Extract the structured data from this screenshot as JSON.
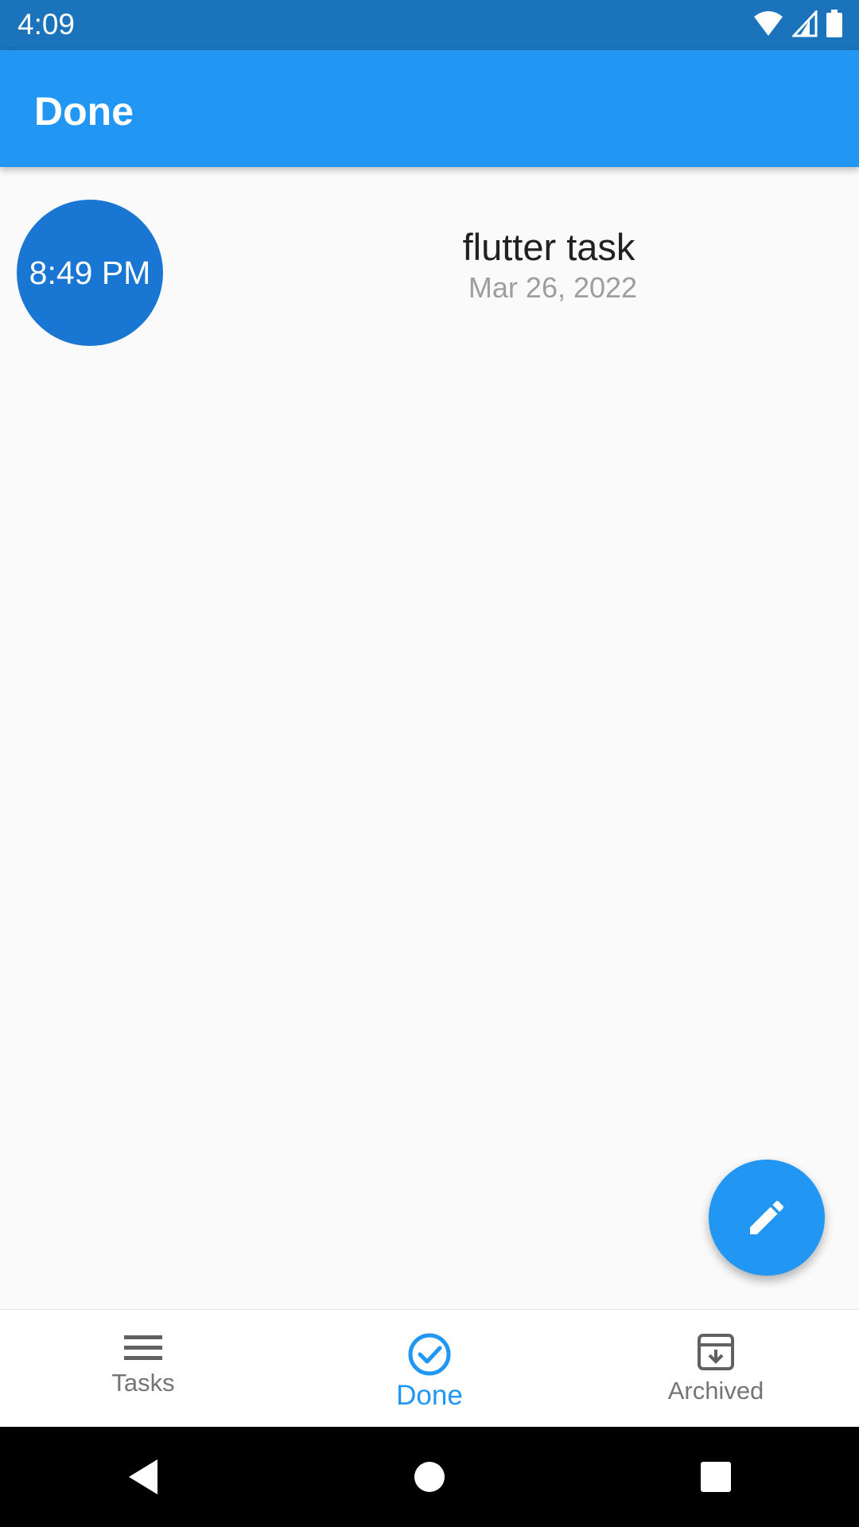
{
  "status_bar": {
    "time": "4:09"
  },
  "app_bar": {
    "title": "Done"
  },
  "tasks": [
    {
      "time": "8:49 PM",
      "title": "flutter task",
      "date": "Mar 26, 2022"
    }
  ],
  "bottom_nav": {
    "items": [
      {
        "label": "Tasks",
        "icon": "menu-icon",
        "active": false
      },
      {
        "label": "Done",
        "icon": "check-circle-icon",
        "active": true
      },
      {
        "label": "Archived",
        "icon": "archive-icon",
        "active": false
      }
    ]
  },
  "fab": {
    "icon": "edit-icon"
  },
  "colors": {
    "status_bar": "#1a73bb",
    "app_bar": "#2196f3",
    "time_circle": "#1976d2",
    "accent": "#2196f3"
  }
}
